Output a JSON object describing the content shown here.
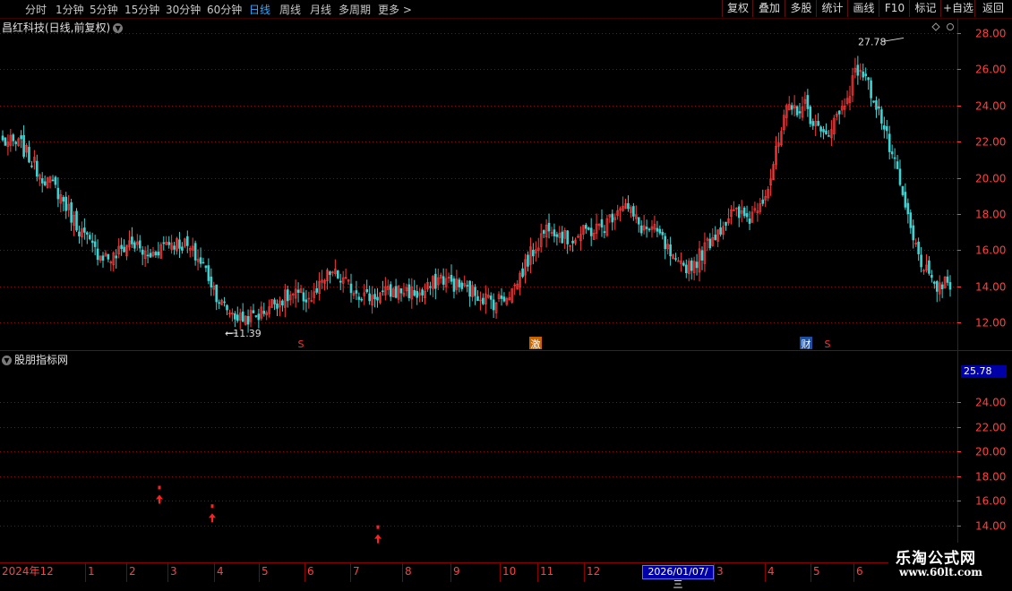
{
  "toolbar": {
    "periods": [
      "分时",
      "1分钟",
      "5分钟",
      "15分钟",
      "30分钟",
      "60分钟",
      "日线",
      "周线",
      "月线",
      "多周期",
      "更多 >"
    ],
    "active_period": "日线",
    "right_buttons": [
      "复权",
      "叠加",
      "多股",
      "统计",
      "画线",
      "F10",
      "标记",
      "+自选",
      "返回"
    ]
  },
  "main_chart": {
    "title": "昌红科技(日线,前复权)",
    "y_ticks": [
      "28.00",
      "26.00",
      "24.00",
      "22.00",
      "20.00",
      "18.00",
      "16.00",
      "14.00",
      "12.00"
    ],
    "high_label": "27.78",
    "low_label": "11.39",
    "event_markers": [
      "S",
      "激",
      "财",
      "S"
    ]
  },
  "indicator": {
    "title": "股朋指标网",
    "current_price": "25.78",
    "y_ticks": [
      "24.00",
      "22.00",
      "20.00",
      "18.00",
      "16.00",
      "14.00"
    ]
  },
  "date_axis": {
    "labels": [
      "2024年12",
      "1",
      "2",
      "3",
      "4",
      "5",
      "6",
      "7",
      "8",
      "9",
      "10",
      "11",
      "12",
      "3",
      "4",
      "5",
      "6"
    ],
    "cursor_date": "2026/01/07/三"
  },
  "watermark": {
    "name": "乐淘公式网",
    "url": "www.60lt.com"
  },
  "colors": {
    "up": "#ff3b3b",
    "down": "#3fd4d4",
    "grid": "#7a1010",
    "axis_text": "#ff4040",
    "active_tab": "#2fa8ff",
    "badge": "#0000a8"
  },
  "chart_data": {
    "type": "candlestick",
    "title": "昌红科技(日线,前复权)",
    "ylim": [
      11.0,
      28.2
    ],
    "x": [
      "2024-12",
      "2025-01",
      "2025-02",
      "2025-03",
      "2025-04",
      "2025-05",
      "2025-06",
      "2025-07",
      "2025-08",
      "2025-09",
      "2025-10",
      "2025-11",
      "2025-12",
      "2026-01",
      "2026-03",
      "2026-04",
      "2026-05",
      "2026-06"
    ],
    "series": [
      {
        "values": [
          22.0,
          21.8,
          20.3,
          19.3,
          17.5,
          16.0,
          15.5,
          16.5,
          15.6,
          16.5,
          16.3,
          15.2,
          13.0,
          12.2,
          12.4,
          13.2,
          13.5,
          13.3,
          14.8,
          14.0,
          13.4,
          13.6,
          13.8,
          13.5,
          14.5,
          14.0,
          13.6,
          13.1,
          13.8,
          15.8,
          17.5,
          16.5,
          17.0,
          17.3,
          18.7,
          17.3,
          16.9,
          15.0,
          15.3,
          16.8,
          18.0,
          17.8,
          19.5,
          23.6,
          24.0,
          22.2,
          23.7,
          26.2,
          24.0,
          20.5,
          16.4,
          14.0,
          14.1
        ]
      }
    ],
    "indicator_signals": [
      16.5,
      15.0,
      13.3
    ],
    "high": 27.78,
    "low": 11.39
  }
}
